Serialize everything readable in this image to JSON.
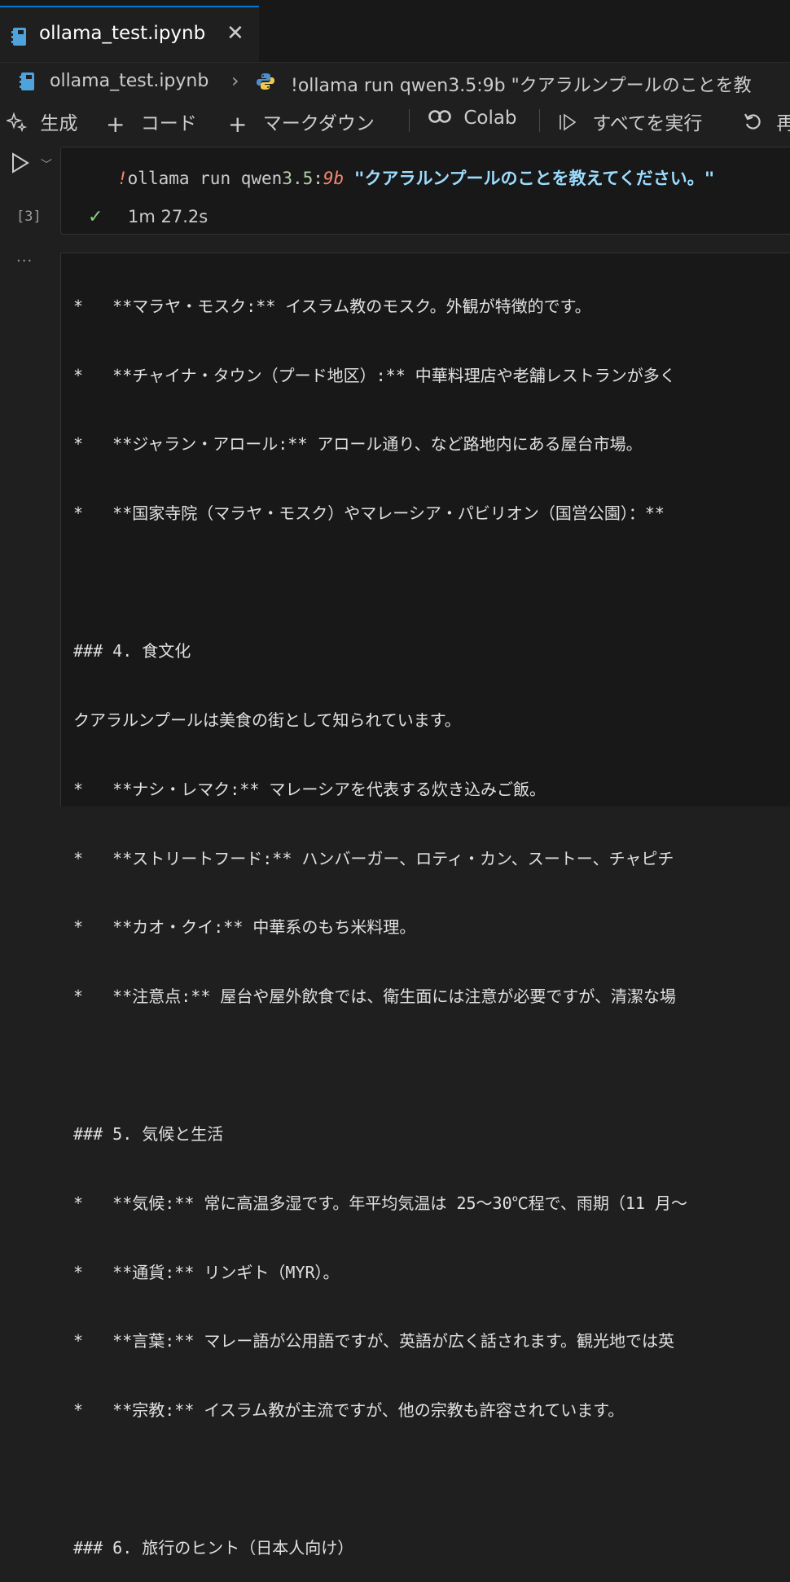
{
  "tab": {
    "label": "ollama_test.ipynb",
    "close": "✕",
    "icon": "notebook-icon"
  },
  "breadcrumb": {
    "file": "ollama_test.ipynb",
    "separator": "›",
    "cell": "!ollama run qwen3.5:9b \"クアラルンプールのことを教"
  },
  "toolbar": {
    "generate": "生成",
    "code": "コード",
    "markdown": "マークダウン",
    "colab": "Colab",
    "run_all": "すべてを実行",
    "restart": "再"
  },
  "cell": {
    "execution_count": "[3]",
    "code": {
      "bang": "!",
      "cmd": "ollama run qwen",
      "ver": "3.5",
      "colon": ":",
      "tag": "9b",
      "space": " ",
      "prompt": "\"クアラルンプールのことを教えてください。\""
    },
    "status_time": "1m 27.2s",
    "output_menu": "···"
  },
  "output": {
    "lines": [
      "*   **マラヤ・モスク:** イスラム教のモスク。外観が特徴的です。",
      "*   **チャイナ・タウン（プード地区）:** 中華料理店や老舗レストランが多く",
      "*   **ジャラン・アロール:** アロール通り、など路地内にある屋台市場。",
      "*   **国家寺院（マラヤ・モスク）やマレーシア・パビリオン（国営公園）：**",
      "",
      "### 4. 食文化",
      "クアラルンプールは美食の街として知られています。",
      "*   **ナシ・レマク:** マレーシアを代表する炊き込みご飯。",
      "*   **ストリートフード:** ハンバーガー、ロティ・カン、スートー、チャピチ",
      "*   **カオ・クイ:** 中華系のもち米料理。",
      "*   **注意点:** 屋台や屋外飲食では、衛生面には注意が必要ですが、清潔な場",
      "",
      "### 5. 気候と生活",
      "*   **気候:** 常に高温多湿です。年平均気温は 25〜30℃程で、雨期（11 月〜",
      "*   **通貨:** リンギト（MYR）。",
      "*   **言葉:** マレー語が公用語ですが、英語が広く話されます。観光地では英",
      "*   **宗教:** イスラム教が主流ですが、他の宗教も許容されています。",
      "",
      "### 6. 旅行のヒント（日本人向け）"
    ]
  }
}
